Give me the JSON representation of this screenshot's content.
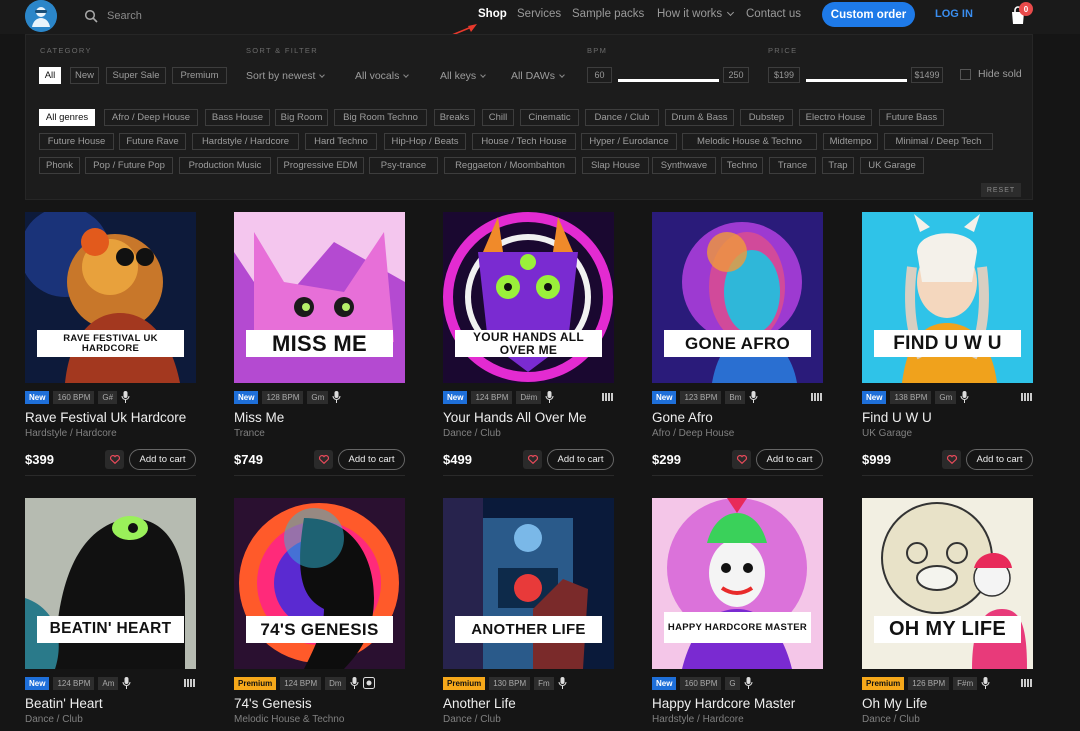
{
  "header": {
    "search_placeholder": "Search",
    "nav": [
      "Shop",
      "Services",
      "Sample packs",
      "How it works",
      "Contact us"
    ],
    "custom_order": "Custom order",
    "login": "LOG IN",
    "cart_count": "0"
  },
  "filter": {
    "category_label": "CATEGORY",
    "categories": [
      "All",
      "New",
      "Super Sale",
      "Premium"
    ],
    "sort_label": "SORT & FILTER",
    "sort": "Sort by newest",
    "vocals": "All vocals",
    "keys": "All keys",
    "daws": "All DAWs",
    "bpm_label": "BPM",
    "bpm_min": "60",
    "bpm_max": "250",
    "price_label": "PRICE",
    "price_min": "$199",
    "price_max": "$1499",
    "hide_sold": "Hide sold",
    "reset": "RESET",
    "genres": [
      "All genres",
      "Afro / Deep House",
      "Bass House",
      "Big Room",
      "Big Room Techno",
      "Breaks",
      "Chill",
      "Cinematic",
      "Dance / Club",
      "Drum & Bass",
      "Dubstep",
      "Electro House",
      "Future Bass",
      "Future House",
      "Future Rave",
      "Hardstyle / Hardcore",
      "Hard Techno",
      "Hip-Hop / Beats",
      "House / Tech House",
      "Hyper / Eurodance",
      "Melodic House & Techno",
      "Midtempo",
      "Minimal / Deep Tech",
      "Phonk",
      "Pop / Future Pop",
      "Production Music",
      "Progressive EDM",
      "Psy-trance",
      "Reggaeton / Moombahton",
      "Slap House",
      "Synthwave",
      "Techno",
      "Trance",
      "Trap",
      "UK Garage"
    ]
  },
  "products": [
    {
      "art_text": "RAVE FESTIVAL UK HARDCORE",
      "badge": "New",
      "bpm": "160 BPM",
      "key": "G#",
      "title": "Rave Festival Uk Hardcore",
      "genre": "Hardstyle / Hardcore",
      "price": "$399",
      "add": "Add to cart"
    },
    {
      "art_text": "MISS ME",
      "badge": "New",
      "bpm": "128 BPM",
      "key": "Gm",
      "title": "Miss Me",
      "genre": "Trance",
      "price": "$749",
      "add": "Add to cart"
    },
    {
      "art_text": "YOUR HANDS ALL OVER ME",
      "badge": "New",
      "bpm": "124 BPM",
      "key": "D#m",
      "title": "Your Hands All Over Me",
      "genre": "Dance / Club",
      "price": "$499",
      "add": "Add to cart"
    },
    {
      "art_text": "GONE AFRO",
      "badge": "New",
      "bpm": "123 BPM",
      "key": "Bm",
      "title": "Gone Afro",
      "genre": "Afro / Deep House",
      "price": "$299",
      "add": "Add to cart"
    },
    {
      "art_text": "FIND U W U",
      "badge": "New",
      "bpm": "138 BPM",
      "key": "Gm",
      "title": "Find U W U",
      "genre": "UK Garage",
      "price": "$999",
      "add": "Add to cart"
    },
    {
      "art_text": "BEATIN' HEART",
      "badge": "New",
      "bpm": "124 BPM",
      "key": "Am",
      "title": "Beatin' Heart",
      "genre": "Dance / Club"
    },
    {
      "art_text": "74'S GENESIS",
      "badge": "Premium",
      "bpm": "124 BPM",
      "key": "Dm",
      "title": "74's Genesis",
      "genre": "Melodic House & Techno"
    },
    {
      "art_text": "ANOTHER LIFE",
      "badge": "Premium",
      "bpm": "130 BPM",
      "key": "Fm",
      "title": "Another Life",
      "genre": "Dance / Club"
    },
    {
      "art_text": "HAPPY HARDCORE MASTER",
      "badge": "New",
      "bpm": "160 BPM",
      "key": "G",
      "title": "Happy Hardcore Master",
      "genre": "Hardstyle / Hardcore"
    },
    {
      "art_text": "OH MY LIFE",
      "badge": "Premium",
      "bpm": "126 BPM",
      "key": "F#m",
      "title": "Oh My Life",
      "genre": "Dance / Club"
    }
  ]
}
